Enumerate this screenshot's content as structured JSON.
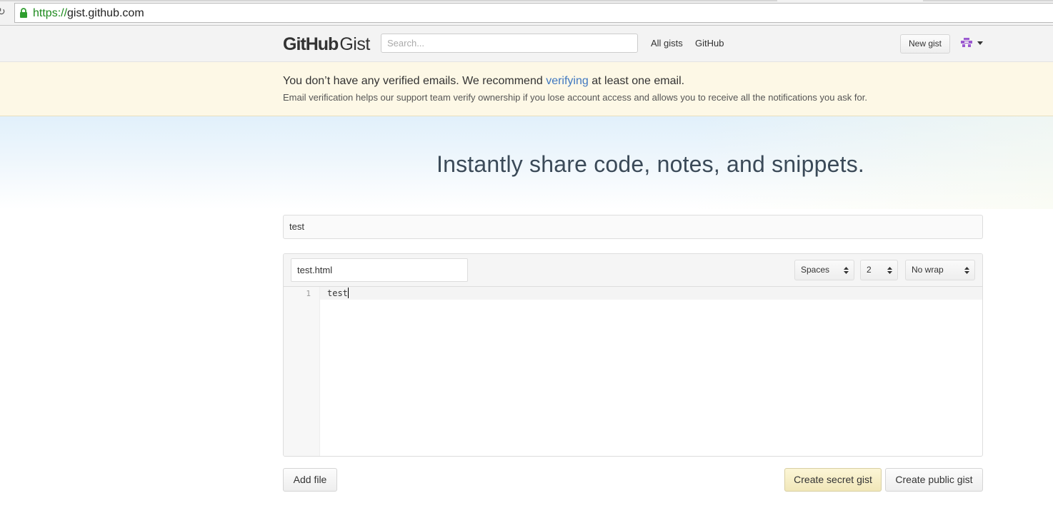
{
  "browser": {
    "url_scheme": "https://",
    "url_host": "gist.github.com"
  },
  "header": {
    "logo_github": "GitHub",
    "logo_gist": "Gist",
    "search_placeholder": "Search...",
    "nav": [
      "All gists",
      "GitHub"
    ],
    "new_gist_label": "New gist"
  },
  "flash": {
    "title_before": "You don’t have any verified emails. We recommend ",
    "title_link": "verifying",
    "title_after": " at least one email.",
    "subtitle": "Email verification helps our support team verify ownership if you lose account access and allows you to receive all the notifications you ask for."
  },
  "hero": {
    "tagline": "Instantly share code, notes, and snippets."
  },
  "form": {
    "description_value": "test",
    "filename_value": "test.html",
    "indent_mode": "Spaces",
    "indent_size": "2",
    "wrap_mode": "No wrap",
    "lines": [
      {
        "number": "1",
        "text": "test"
      }
    ],
    "add_file_label": "Add file",
    "create_secret_label": "Create secret gist",
    "create_public_label": "Create public gist"
  },
  "colors": {
    "link": "#4078c0",
    "flash_bg": "#fdf8e6",
    "secure_green": "#1d8a1d",
    "avatar_purple": "#9b59d0"
  }
}
